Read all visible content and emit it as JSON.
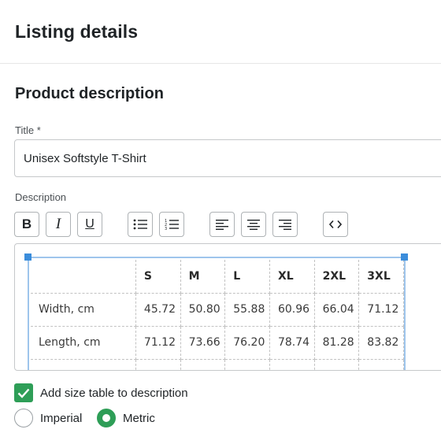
{
  "header": {
    "title": "Listing details"
  },
  "section": {
    "title": "Product description"
  },
  "title_field": {
    "label": "Title *",
    "value": "Unisex Softstyle T-Shirt"
  },
  "description_field": {
    "label": "Description"
  },
  "toolbar": {
    "bold": "B",
    "italic": "I",
    "underline": "U",
    "icons": [
      "bold-icon",
      "italic-icon",
      "underline-icon",
      "bulleted-list-icon",
      "numbered-list-icon",
      "align-left-icon",
      "align-center-icon",
      "align-right-icon",
      "code-view-icon"
    ]
  },
  "size_table": {
    "headers": [
      "",
      "S",
      "M",
      "L",
      "XL",
      "2XL",
      "3XL"
    ],
    "rows": [
      {
        "label": "Width, cm",
        "values": [
          "45.72",
          "50.80",
          "55.88",
          "60.96",
          "66.04",
          "71.12"
        ]
      },
      {
        "label": "Length, cm",
        "values": [
          "71.12",
          "73.66",
          "76.20",
          "78.74",
          "81.28",
          "83.82"
        ]
      }
    ]
  },
  "options": {
    "add_size_table": {
      "label": "Add size table to description",
      "checked": true
    },
    "units": [
      {
        "label": "Imperial",
        "selected": false
      },
      {
        "label": "Metric",
        "selected": true
      }
    ]
  },
  "colors": {
    "accent": "#2e9e57",
    "selection": "#3b8ddb"
  }
}
